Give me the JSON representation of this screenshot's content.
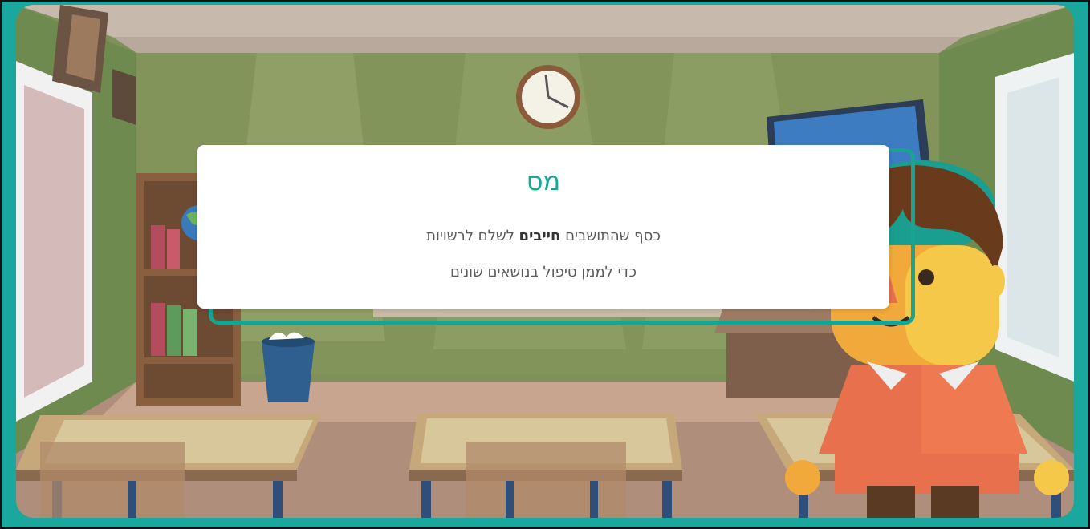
{
  "slide": {
    "title": "מס",
    "line1_prefix": "כסף שהתושבים",
    "line1_bold": "חייבים",
    "line1_suffix": "לשלם לרשויות",
    "line2": "כדי לממן טיפול בנושאים שונים"
  },
  "colors": {
    "frame": "#1aa79d",
    "title": "#14a894",
    "wall": "#7f915b"
  },
  "icons": {
    "clock": "clock-icon",
    "character": "student-character",
    "globe": "globe-icon",
    "trash": "trash-bin-icon"
  }
}
